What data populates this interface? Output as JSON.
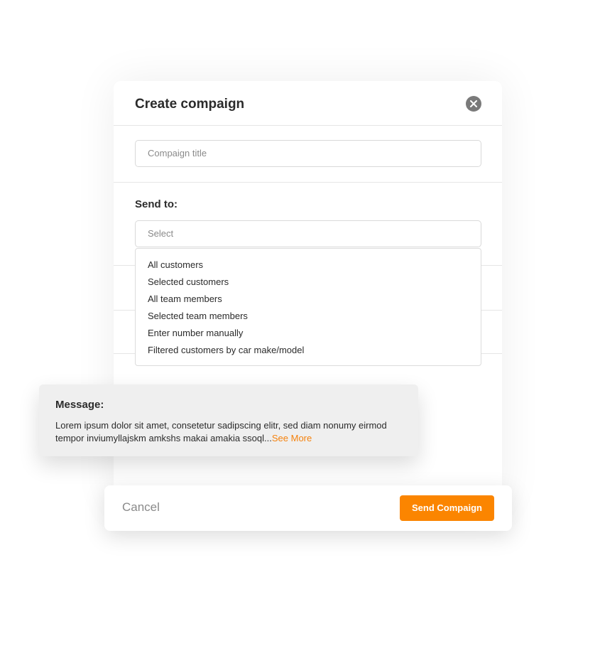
{
  "modal": {
    "title": "Create compaign",
    "close_icon": "close-circle-icon",
    "campaign_title_placeholder": "Compaign title",
    "send_to": {
      "label": "Send to:",
      "select_placeholder": "Select",
      "options": [
        "All customers",
        "Selected customers",
        "All team members",
        "Selected team members",
        "Enter number manually",
        "Filtered customers by car make/model"
      ]
    }
  },
  "message": {
    "label": "Message:",
    "text": "Lorem ipsum dolor sit amet, consetetur sadipscing elitr, sed diam nonumy eirmod tempor inviumyllajskm amkshs makai amakia ssoql...",
    "see_more": "See More"
  },
  "footer": {
    "cancel_label": "Cancel",
    "send_label": "Send Compaign"
  },
  "colors": {
    "accent": "#fb8500",
    "link": "#f5820d",
    "close_icon_bg": "#7a7a7a",
    "message_bg": "#efefef"
  }
}
